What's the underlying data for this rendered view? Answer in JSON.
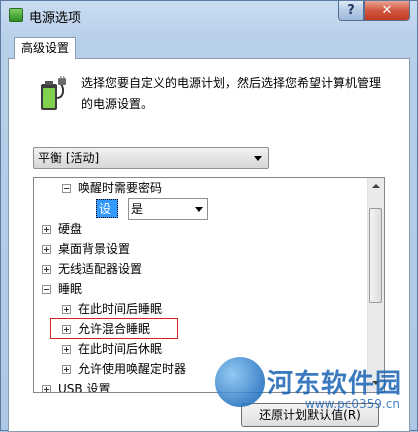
{
  "window": {
    "title": "电源选项",
    "help_glyph": "?",
    "close_glyph": "✕"
  },
  "tab": {
    "label": "高级设置"
  },
  "description": "选择您要自定义的电源计划，然后选择您希望计算机管理的电源设置。",
  "plan_select": {
    "value": "平衡 [活动]"
  },
  "tree": {
    "rows": [
      {
        "label": "唤醒时需要密码",
        "expander": "minus"
      },
      {
        "label": "硬盘",
        "expander": "plus"
      },
      {
        "label": "桌面背景设置",
        "expander": "plus"
      },
      {
        "label": "无线适配器设置",
        "expander": "plus"
      },
      {
        "label": "睡眠",
        "expander": "minus"
      },
      {
        "label": "在此时间后睡眠",
        "expander": "plus"
      },
      {
        "label": "允许混合睡眠",
        "expander": "plus"
      },
      {
        "label": "在此时间后休眠",
        "expander": "plus"
      },
      {
        "label": "允许使用唤醒定时器",
        "expander": "plus"
      },
      {
        "label": "USB 设置",
        "expander": "plus"
      }
    ],
    "setting": {
      "label": "设置:",
      "value": "是"
    },
    "highlight_color": "#d32323"
  },
  "buttons": {
    "restore": "还原计划默认值(R)"
  },
  "watermark": {
    "text": "河东软件园",
    "url": "www.pc0359.cn"
  },
  "colors": {
    "selection": "#3399ff",
    "watermark": "#1a63b5"
  }
}
